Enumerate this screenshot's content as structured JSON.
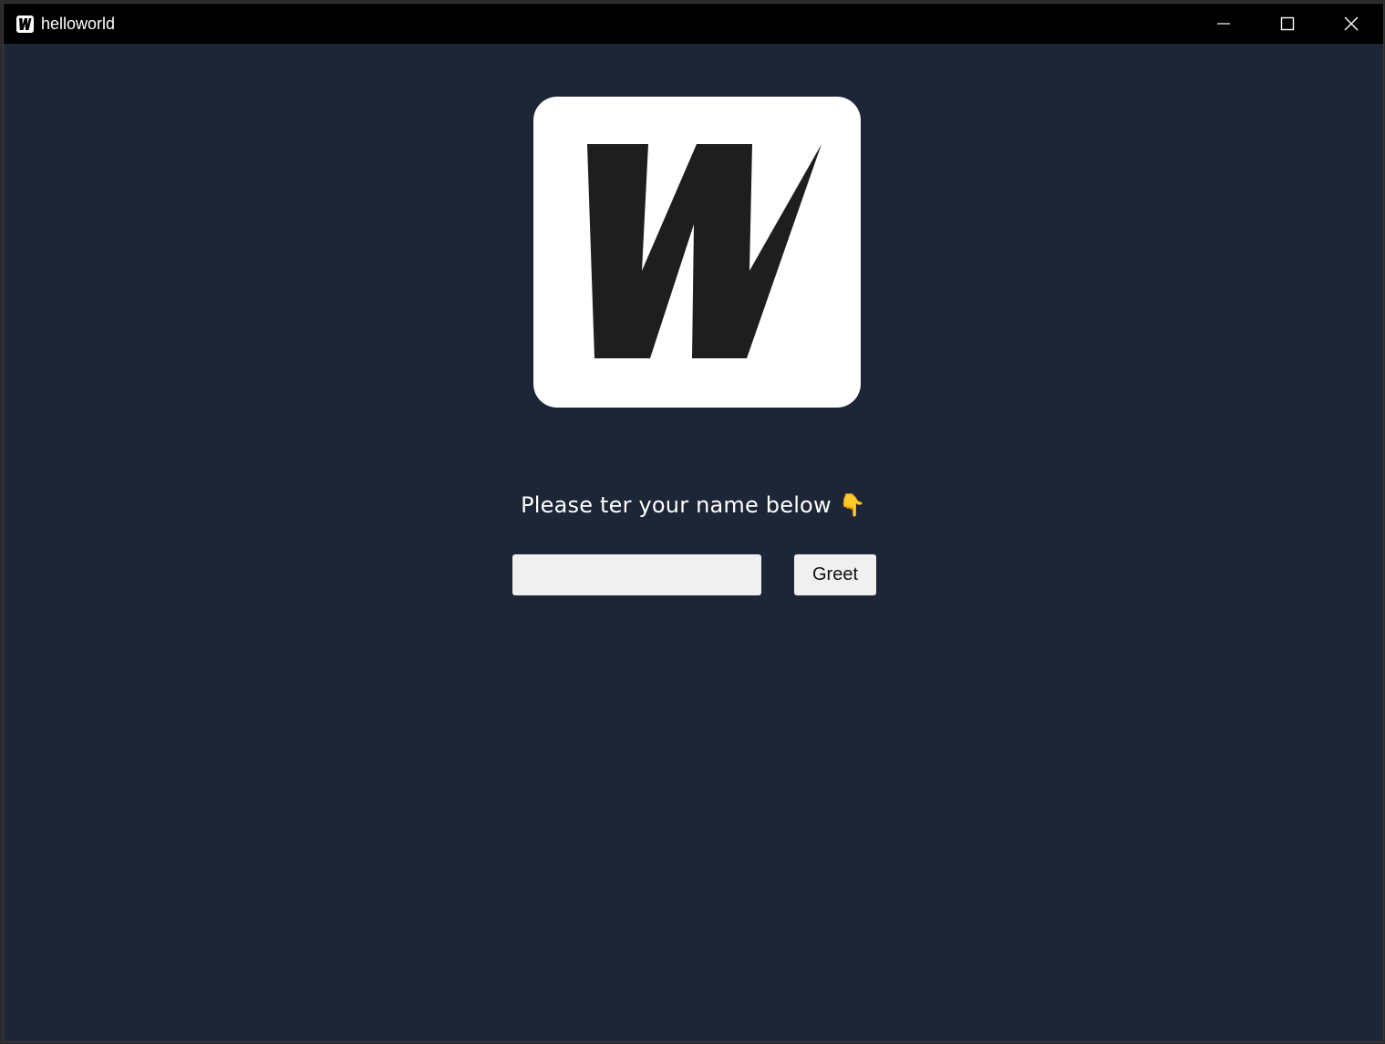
{
  "window": {
    "title": "helloworld",
    "app_icon": "w-logo-icon",
    "controls": [
      "minimize-icon",
      "maximize-icon",
      "close-icon"
    ]
  },
  "main": {
    "logo": "w-logo",
    "prompt_text": "Please ter your name below",
    "prompt_emoji": "👇",
    "name_input": {
      "value": "",
      "placeholder": ""
    },
    "greet_label": "Greet"
  },
  "colors": {
    "background": "#1c2637",
    "titlebar": "#000000",
    "logo_bg": "#ffffff",
    "logo_letter": "#1e1e1e",
    "input_bg": "#f0f0f0"
  }
}
